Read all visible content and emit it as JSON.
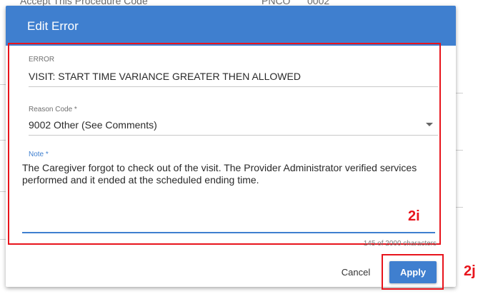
{
  "background": {
    "header_fragments": [
      "Accept This Procedure Code",
      "PNCO",
      "0002"
    ]
  },
  "dialog": {
    "title": "Edit Error",
    "error": {
      "label": "ERROR",
      "value": "VISIT: START TIME VARIANCE GREATER THEN ALLOWED"
    },
    "reason_code": {
      "label": "Reason Code *",
      "value": "9002 Other (See Comments)"
    },
    "note": {
      "label": "Note *",
      "value": "The Caregiver forgot to check out of the visit. The Provider Administrator verified services performed and it ended at the scheduled ending time.",
      "char_count": "145 of 2000 characters"
    },
    "buttons": {
      "cancel": "Cancel",
      "apply": "Apply"
    }
  },
  "annotations": {
    "form_label": "2i",
    "apply_label": "2j"
  },
  "colors": {
    "header_blue": "#3f7fcf",
    "annotation_red": "#e8141c"
  }
}
